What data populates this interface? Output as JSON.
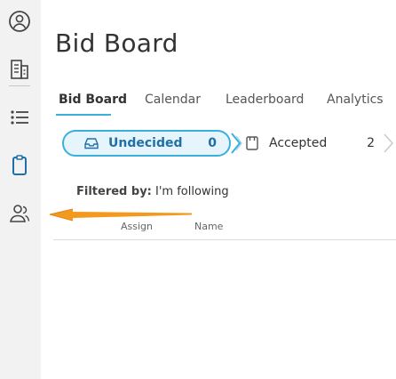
{
  "sidebar": {
    "icons": [
      "person-circle-icon",
      "building-icon",
      "list-icon",
      "clipboard-icon",
      "people-icon"
    ]
  },
  "header": {
    "title": "Bid Board"
  },
  "tabs": [
    {
      "label": "Bid Board",
      "active": true
    },
    {
      "label": "Calendar"
    },
    {
      "label": "Leaderboard"
    },
    {
      "label": "Analytics"
    }
  ],
  "stages": [
    {
      "label": "Undecided",
      "count": "0",
      "icon": "inbox-icon",
      "selected": true
    },
    {
      "label": "Accepted",
      "count": "2",
      "icon": "bracket-box-icon"
    }
  ],
  "filter": {
    "key": "Filtered by:",
    "value": "I'm following"
  },
  "table": {
    "columns": [
      "Assign",
      "Name"
    ]
  },
  "colors": {
    "accent": "#3cb0dc",
    "annotation_arrow": "#f39a1e",
    "sidebar_bg": "#f2f2f2"
  }
}
